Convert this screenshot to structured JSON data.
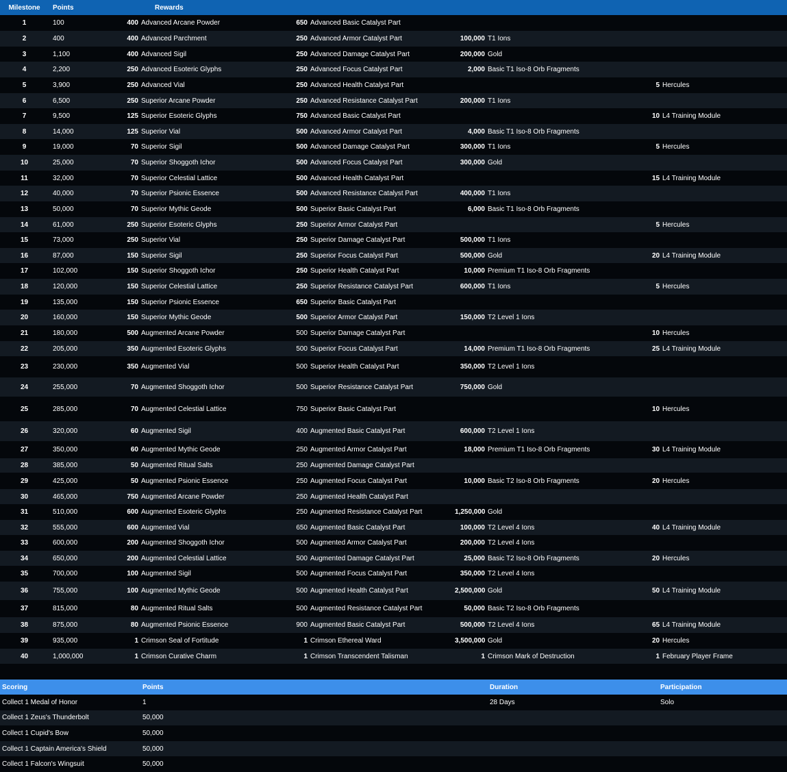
{
  "headers": {
    "milestone": "Milestone",
    "points": "Points",
    "rewards": "Rewards"
  },
  "milestones": [
    {
      "m": "1",
      "p": "100",
      "r": [
        [
          "400",
          "Advanced Arcane Powder"
        ],
        [
          "650",
          "Advanced Basic Catalyst Part"
        ],
        [
          "",
          ""
        ],
        [
          "",
          ""
        ]
      ]
    },
    {
      "m": "2",
      "p": "400",
      "r": [
        [
          "400",
          "Advanced Parchment"
        ],
        [
          "250",
          "Advanced Armor Catalyst Part"
        ],
        [
          "100,000",
          "T1 Ions"
        ],
        [
          "",
          ""
        ]
      ]
    },
    {
      "m": "3",
      "p": "1,100",
      "r": [
        [
          "400",
          "Advanced Sigil"
        ],
        [
          "250",
          "Advanced Damage Catalyst Part"
        ],
        [
          "200,000",
          "Gold"
        ],
        [
          "",
          ""
        ]
      ]
    },
    {
      "m": "4",
      "p": "2,200",
      "r": [
        [
          "250",
          "Advanced Esoteric Glyphs"
        ],
        [
          "250",
          "Advanced Focus Catalyst Part"
        ],
        [
          "2,000",
          "Basic T1 Iso-8 Orb Fragments"
        ],
        [
          "",
          ""
        ]
      ]
    },
    {
      "m": "5",
      "p": "3,900",
      "r": [
        [
          "250",
          "Advanced Vial"
        ],
        [
          "250",
          "Advanced Health Catalyst Part"
        ],
        [
          "",
          ""
        ],
        [
          "5",
          "Hercules"
        ]
      ]
    },
    {
      "m": "6",
      "p": "6,500",
      "r": [
        [
          "250",
          "Superior Arcane Powder"
        ],
        [
          "250",
          "Advanced Resistance Catalyst Part"
        ],
        [
          "200,000",
          "T1 Ions"
        ],
        [
          "",
          ""
        ]
      ]
    },
    {
      "m": "7",
      "p": "9,500",
      "r": [
        [
          "125",
          "Superior Esoteric Glyphs"
        ],
        [
          "750",
          "Advanced Basic Catalyst Part"
        ],
        [
          "",
          ""
        ],
        [
          "10",
          "L4 Training Module"
        ]
      ]
    },
    {
      "m": "8",
      "p": "14,000",
      "r": [
        [
          "125",
          "Superior Vial"
        ],
        [
          "500",
          "Advanced Armor Catalyst Part"
        ],
        [
          "4,000",
          "Basic T1 Iso-8 Orb Fragments"
        ],
        [
          "",
          ""
        ]
      ]
    },
    {
      "m": "9",
      "p": "19,000",
      "r": [
        [
          "70",
          "Superior Sigil"
        ],
        [
          "500",
          "Advanced Damage Catalyst Part"
        ],
        [
          "300,000",
          "T1 Ions"
        ],
        [
          "5",
          "Hercules"
        ]
      ]
    },
    {
      "m": "10",
      "p": "25,000",
      "r": [
        [
          "70",
          "Superior Shoggoth Ichor"
        ],
        [
          "500",
          "Advanced Focus Catalyst Part"
        ],
        [
          "300,000",
          "Gold"
        ],
        [
          "",
          ""
        ]
      ]
    },
    {
      "m": "11",
      "p": "32,000",
      "r": [
        [
          "70",
          "Superior Celestial Lattice"
        ],
        [
          "500",
          "Advanced Health Catalyst Part"
        ],
        [
          "",
          ""
        ],
        [
          "15",
          "L4 Training Module"
        ]
      ]
    },
    {
      "m": "12",
      "p": "40,000",
      "r": [
        [
          "70",
          "Superior Psionic Essence"
        ],
        [
          "500",
          "Advanced Resistance Catalyst Part"
        ],
        [
          "400,000",
          "T1 Ions"
        ],
        [
          "",
          ""
        ]
      ]
    },
    {
      "m": "13",
      "p": "50,000",
      "r": [
        [
          "70",
          "Superior Mythic Geode"
        ],
        [
          "500",
          "Superior Basic Catalyst Part"
        ],
        [
          "6,000",
          "Basic T1 Iso-8 Orb Fragments"
        ],
        [
          "",
          ""
        ]
      ]
    },
    {
      "m": "14",
      "p": "61,000",
      "r": [
        [
          "250",
          "Superior Esoteric Glyphs"
        ],
        [
          "250",
          "Superior Armor Catalyst Part"
        ],
        [
          "",
          ""
        ],
        [
          "5",
          "Hercules"
        ]
      ]
    },
    {
      "m": "15",
      "p": "73,000",
      "r": [
        [
          "250",
          "Superior Vial"
        ],
        [
          "250",
          "Superior Damage Catalyst Part"
        ],
        [
          "500,000",
          "T1 Ions"
        ],
        [
          "",
          ""
        ]
      ]
    },
    {
      "m": "16",
      "p": "87,000",
      "r": [
        [
          "150",
          "Superior Sigil"
        ],
        [
          "250",
          "Superior Focus Catalyst Part"
        ],
        [
          "500,000",
          "Gold"
        ],
        [
          "20",
          "L4 Training Module"
        ]
      ]
    },
    {
      "m": "17",
      "p": "102,000",
      "r": [
        [
          "150",
          "Superior Shoggoth Ichor"
        ],
        [
          "250",
          "Superior Health Catalyst Part"
        ],
        [
          "10,000",
          "Premium T1 Iso-8 Orb Fragments"
        ],
        [
          "",
          ""
        ]
      ]
    },
    {
      "m": "18",
      "p": "120,000",
      "r": [
        [
          "150",
          "Superior Celestial Lattice"
        ],
        [
          "250",
          "Superior Resistance Catalyst Part"
        ],
        [
          "600,000",
          "T1 Ions"
        ],
        [
          "5",
          "Hercules"
        ]
      ]
    },
    {
      "m": "19",
      "p": "135,000",
      "r": [
        [
          "150",
          "Superior Psionic Essence"
        ],
        [
          "650",
          "Superior Basic Catalyst Part"
        ],
        [
          "",
          ""
        ],
        [
          "",
          ""
        ]
      ]
    },
    {
      "m": "20",
      "p": "160,000",
      "r": [
        [
          "150",
          "Superior Mythic Geode"
        ],
        [
          "500",
          "Superior Armor Catalyst Part"
        ],
        [
          "150,000",
          "T2 Level 1 Ions"
        ],
        [
          "",
          ""
        ]
      ]
    },
    {
      "m": "21",
      "p": "180,000",
      "r": [
        [
          "500",
          "Augmented Arcane Powder"
        ],
        [
          "500",
          "Superior Damage Catalyst Part"
        ],
        [
          "",
          ""
        ],
        [
          "10",
          "Hercules"
        ]
      ]
    },
    {
      "m": "22",
      "p": "205,000",
      "r": [
        [
          "350",
          "Augmented Esoteric Glyphs"
        ],
        [
          "500",
          "Superior Focus Catalyst Part"
        ],
        [
          "14,000",
          "Premium T1 Iso-8 Orb Fragments"
        ],
        [
          "25",
          "L4 Training Module"
        ]
      ]
    },
    {
      "m": "23",
      "p": "230,000",
      "r": [
        [
          "350",
          "Augmented Vial"
        ],
        [
          "500",
          "Superior Health Catalyst Part"
        ],
        [
          "350,000",
          "T2 Level 1 Ions"
        ],
        [
          "",
          ""
        ]
      ]
    },
    {
      "m": "24",
      "p": "255,000",
      "r": [
        [
          "70",
          "Augmented Shoggoth Ichor"
        ],
        [
          "500",
          "Superior Resistance Catalyst Part"
        ],
        [
          "750,000",
          "Gold"
        ],
        [
          "",
          ""
        ]
      ]
    },
    {
      "m": "25",
      "p": "285,000",
      "r": [
        [
          "70",
          "Augmented Celestial Lattice"
        ],
        [
          "750",
          "Superior Basic Catalyst Part"
        ],
        [
          "",
          ""
        ],
        [
          "10",
          "Hercules"
        ]
      ]
    },
    {
      "m": "26",
      "p": "320,000",
      "r": [
        [
          "60",
          "Augmented Sigil"
        ],
        [
          "400",
          "Augmented Basic Catalyst Part"
        ],
        [
          "600,000",
          "T2 Level 1 Ions"
        ],
        [
          "",
          ""
        ]
      ]
    },
    {
      "m": "27",
      "p": "350,000",
      "r": [
        [
          "60",
          "Augmented Mythic Geode"
        ],
        [
          "250",
          "Augmented Armor Catalyst Part"
        ],
        [
          "18,000",
          "Premium T1 Iso-8 Orb Fragments"
        ],
        [
          "30",
          "L4 Training Module"
        ]
      ]
    },
    {
      "m": "28",
      "p": "385,000",
      "r": [
        [
          "50",
          "Augmented Ritual Salts"
        ],
        [
          "250",
          "Augmented Damage Catalyst Part"
        ],
        [
          "",
          ""
        ],
        [
          "",
          ""
        ]
      ]
    },
    {
      "m": "29",
      "p": "425,000",
      "r": [
        [
          "50",
          "Augmented Psionic Essence"
        ],
        [
          "250",
          "Augmented Focus Catalyst Part"
        ],
        [
          "10,000",
          "Basic T2 Iso-8 Orb Fragments"
        ],
        [
          "20",
          "Hercules"
        ]
      ]
    },
    {
      "m": "30",
      "p": "465,000",
      "r": [
        [
          "750",
          "Augmented Arcane Powder"
        ],
        [
          "250",
          "Augmented Health Catalyst Part"
        ],
        [
          "",
          ""
        ],
        [
          "",
          ""
        ]
      ]
    },
    {
      "m": "31",
      "p": "510,000",
      "r": [
        [
          "600",
          "Augmented Esoteric Glyphs"
        ],
        [
          "250",
          "Augmented Resistance Catalyst Part"
        ],
        [
          "1,250,000",
          "Gold"
        ],
        [
          "",
          ""
        ]
      ]
    },
    {
      "m": "32",
      "p": "555,000",
      "r": [
        [
          "600",
          "Augmented Vial"
        ],
        [
          "650",
          "Augmented Basic Catalyst Part"
        ],
        [
          "100,000",
          "T2 Level 4 Ions"
        ],
        [
          "40",
          "L4 Training Module"
        ]
      ]
    },
    {
      "m": "33",
      "p": "600,000",
      "r": [
        [
          "200",
          "Augmented Shoggoth Ichor"
        ],
        [
          "500",
          "Augmented Armor Catalyst Part"
        ],
        [
          "200,000",
          "T2 Level 4 Ions"
        ],
        [
          "",
          ""
        ]
      ]
    },
    {
      "m": "34",
      "p": "650,000",
      "r": [
        [
          "200",
          "Augmented Celestial Lattice"
        ],
        [
          "500",
          "Augmented Damage Catalyst Part"
        ],
        [
          "25,000",
          "Basic T2 Iso-8 Orb Fragments"
        ],
        [
          "20",
          "Hercules"
        ]
      ]
    },
    {
      "m": "35",
      "p": "700,000",
      "r": [
        [
          "100",
          "Augmented Sigil"
        ],
        [
          "500",
          "Augmented Focus Catalyst Part"
        ],
        [
          "350,000",
          "T2 Level 4 Ions"
        ],
        [
          "",
          ""
        ]
      ]
    },
    {
      "m": "36",
      "p": "755,000",
      "r": [
        [
          "100",
          "Augmented Mythic Geode"
        ],
        [
          "500",
          "Augmented Health Catalyst Part"
        ],
        [
          "2,500,000",
          "Gold"
        ],
        [
          "50",
          "L4 Training Module"
        ]
      ]
    },
    {
      "m": "37",
      "p": "815,000",
      "r": [
        [
          "80",
          "Augmented Ritual Salts"
        ],
        [
          "500",
          "Augmented Resistance Catalyst Part"
        ],
        [
          "50,000",
          "Basic T2 Iso-8 Orb Fragments"
        ],
        [
          "",
          ""
        ]
      ]
    },
    {
      "m": "38",
      "p": "875,000",
      "r": [
        [
          "80",
          "Augmented Psionic Essence"
        ],
        [
          "900",
          "Augmented Basic Catalyst Part"
        ],
        [
          "500,000",
          "T2 Level 4 Ions"
        ],
        [
          "65",
          "L4 Training Module"
        ]
      ]
    },
    {
      "m": "39",
      "p": "935,000",
      "r": [
        [
          "1",
          "Crimson Seal of Fortitude"
        ],
        [
          "1",
          "Crimson Ethereal Ward"
        ],
        [
          "3,500,000",
          "Gold"
        ],
        [
          "20",
          "Hercules"
        ]
      ]
    },
    {
      "m": "40",
      "p": "1,000,000",
      "r": [
        [
          "1",
          "Crimson Curative Charm"
        ],
        [
          "1",
          "Crimson Transcendent Talisman"
        ],
        [
          "1",
          "Crimson Mark of Destruction"
        ],
        [
          "1",
          "February Player Frame"
        ]
      ]
    }
  ],
  "scoring": {
    "headers": {
      "scoring": "Scoring",
      "points": "Points",
      "duration": "Duration",
      "participation": "Participation"
    },
    "rows": [
      {
        "label": "Collect 1 Medal of Honor",
        "points": "1",
        "duration": "28 Days",
        "participation": "Solo"
      },
      {
        "label": "Collect 1 Zeus's Thunderbolt",
        "points": "50,000",
        "duration": "",
        "participation": ""
      },
      {
        "label": "Collect 1 Cupid's Bow",
        "points": "50,000",
        "duration": "",
        "participation": ""
      },
      {
        "label": "Collect 1 Captain America's Shield",
        "points": "50,000",
        "duration": "",
        "participation": ""
      },
      {
        "label": "Collect 1 Falcon's Wingsuit",
        "points": "50,000",
        "duration": "",
        "participation": ""
      }
    ]
  }
}
